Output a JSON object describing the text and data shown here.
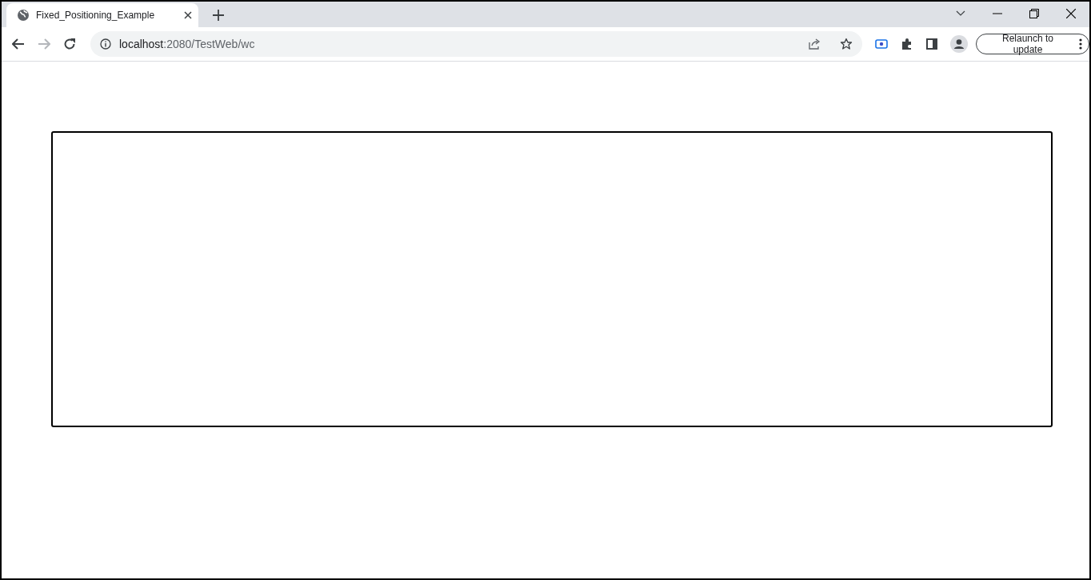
{
  "tabs": [
    {
      "title": "Fixed_Positioning_Example",
      "selected": true
    }
  ],
  "address_bar": {
    "host": "localhost",
    "path": ":2080/TestWeb/wc"
  },
  "toolbar": {
    "nav_forward_disabled": true,
    "relaunch_button": "Relaunch to update"
  },
  "page": {
    "boxes": [
      {
        "kind": "outlined-box"
      }
    ]
  }
}
